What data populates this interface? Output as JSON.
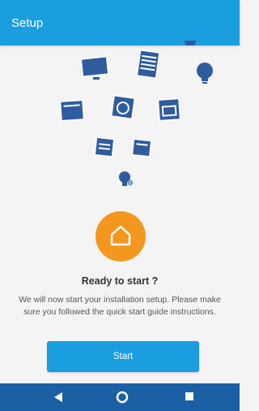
{
  "app_bar": {
    "title": "Setup"
  },
  "illustration": {
    "icons": [
      "tv-icon",
      "fridge-icon",
      "bulb-icon",
      "panel-icon",
      "washer-icon",
      "oven-icon",
      "screen-icon",
      "board-icon",
      "plug-icon"
    ],
    "accent": "#f3971e",
    "icon_color": "#2f5c9e"
  },
  "main": {
    "title": "Ready to start ?",
    "description": "We will now start your installation setup. Please make sure you followed the quick start guide instructions.",
    "start_label": "Start"
  },
  "colors": {
    "primary": "#1b9ee0",
    "nav_bar": "#1b5fa5"
  },
  "nav_bar": {
    "buttons": [
      "back",
      "home",
      "recents"
    ]
  }
}
